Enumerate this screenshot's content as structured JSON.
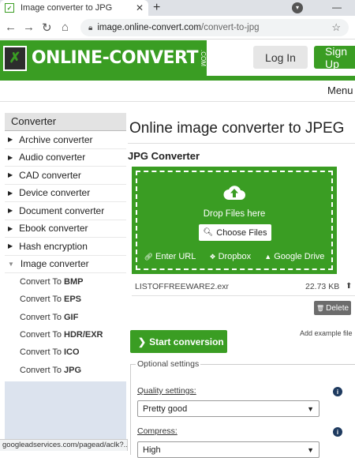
{
  "browser": {
    "tab_title": "Image converter to JPG",
    "tab_close": "✕",
    "new_tab": "+",
    "url_host": "image.online-convert.com",
    "url_path": "/convert-to-jpg"
  },
  "header": {
    "logo_text": "ONLINE-CONVERT",
    "logo_suffix": ".COM",
    "login_label": "Log In",
    "signup_label": "Sign Up",
    "menu_label": "Menu",
    "brand_color": "#3a9d23"
  },
  "sidebar": {
    "heading": "Converter",
    "categories": [
      {
        "label": "Archive converter"
      },
      {
        "label": "Audio converter"
      },
      {
        "label": "CAD converter"
      },
      {
        "label": "Device converter"
      },
      {
        "label": "Document converter"
      },
      {
        "label": "Ebook converter"
      },
      {
        "label": "Hash encryption"
      },
      {
        "label": "Image converter"
      }
    ],
    "subitems": [
      {
        "prefix": "Convert To",
        "format": "BMP"
      },
      {
        "prefix": "Convert To",
        "format": "EPS"
      },
      {
        "prefix": "Convert To",
        "format": "GIF"
      },
      {
        "prefix": "Convert To",
        "format": "HDR/EXR"
      },
      {
        "prefix": "Convert To",
        "format": "ICO"
      },
      {
        "prefix": "Convert To",
        "format": "JPG"
      }
    ]
  },
  "statusbar": {
    "text": "googleadservices.com/pagead/aclk?..."
  },
  "main": {
    "page_title": "Online image converter to JPEG",
    "converter_title": "JPG Converter",
    "drop_label": "Drop Files here",
    "choose_label": "Choose Files",
    "sources": {
      "url": "Enter URL",
      "dropbox": "Dropbox",
      "gdrive": "Google Drive"
    },
    "file": {
      "name": "LISTOFFREEWARE2.exr",
      "size": "22.73 KB"
    },
    "delete_label": "Delete",
    "start_label": "Start conversion",
    "add_example": "Add example file",
    "optional_legend": "Optional settings",
    "quality_label": "Quality settings:",
    "quality_value": "Pretty good",
    "compress_label": "Compress:",
    "compress_value": "High"
  }
}
